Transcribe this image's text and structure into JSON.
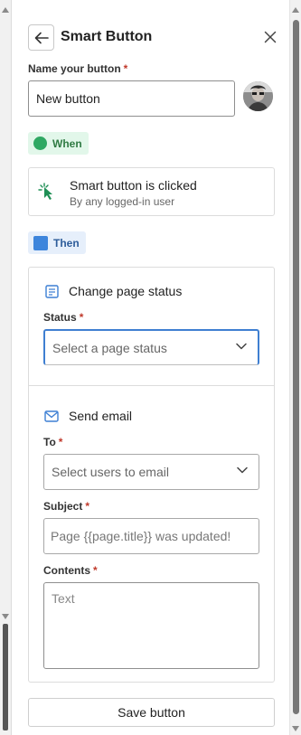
{
  "header": {
    "title": "Smart Button",
    "back_icon": "arrow-left-icon",
    "close_icon": "close-icon"
  },
  "name_field": {
    "label": "Name your button",
    "required_mark": "*",
    "value": "New button"
  },
  "avatar": {
    "icon": "user-avatar"
  },
  "when": {
    "badge": "When",
    "color": "#2fa863",
    "trigger_title": "Smart button is clicked",
    "trigger_subtitle": "By any logged-in user",
    "trigger_icon": "cursor-click-icon"
  },
  "then": {
    "badge": "Then",
    "color": "#3d85dc",
    "actions": [
      {
        "title": "Change page status",
        "icon": "page-status-icon",
        "fields": [
          {
            "label": "Status",
            "required_mark": "*",
            "placeholder": "Select a page status",
            "type": "select"
          }
        ]
      },
      {
        "title": "Send email",
        "icon": "mail-icon",
        "fields": [
          {
            "label": "To",
            "required_mark": "*",
            "placeholder": "Select users to email",
            "type": "select"
          },
          {
            "label": "Subject",
            "required_mark": "*",
            "value": "Page {{page.title}} was updated!",
            "type": "text"
          },
          {
            "label": "Contents",
            "required_mark": "*",
            "placeholder": "Text",
            "type": "textarea"
          }
        ]
      }
    ]
  },
  "footer": {
    "save_label": "Save button"
  }
}
